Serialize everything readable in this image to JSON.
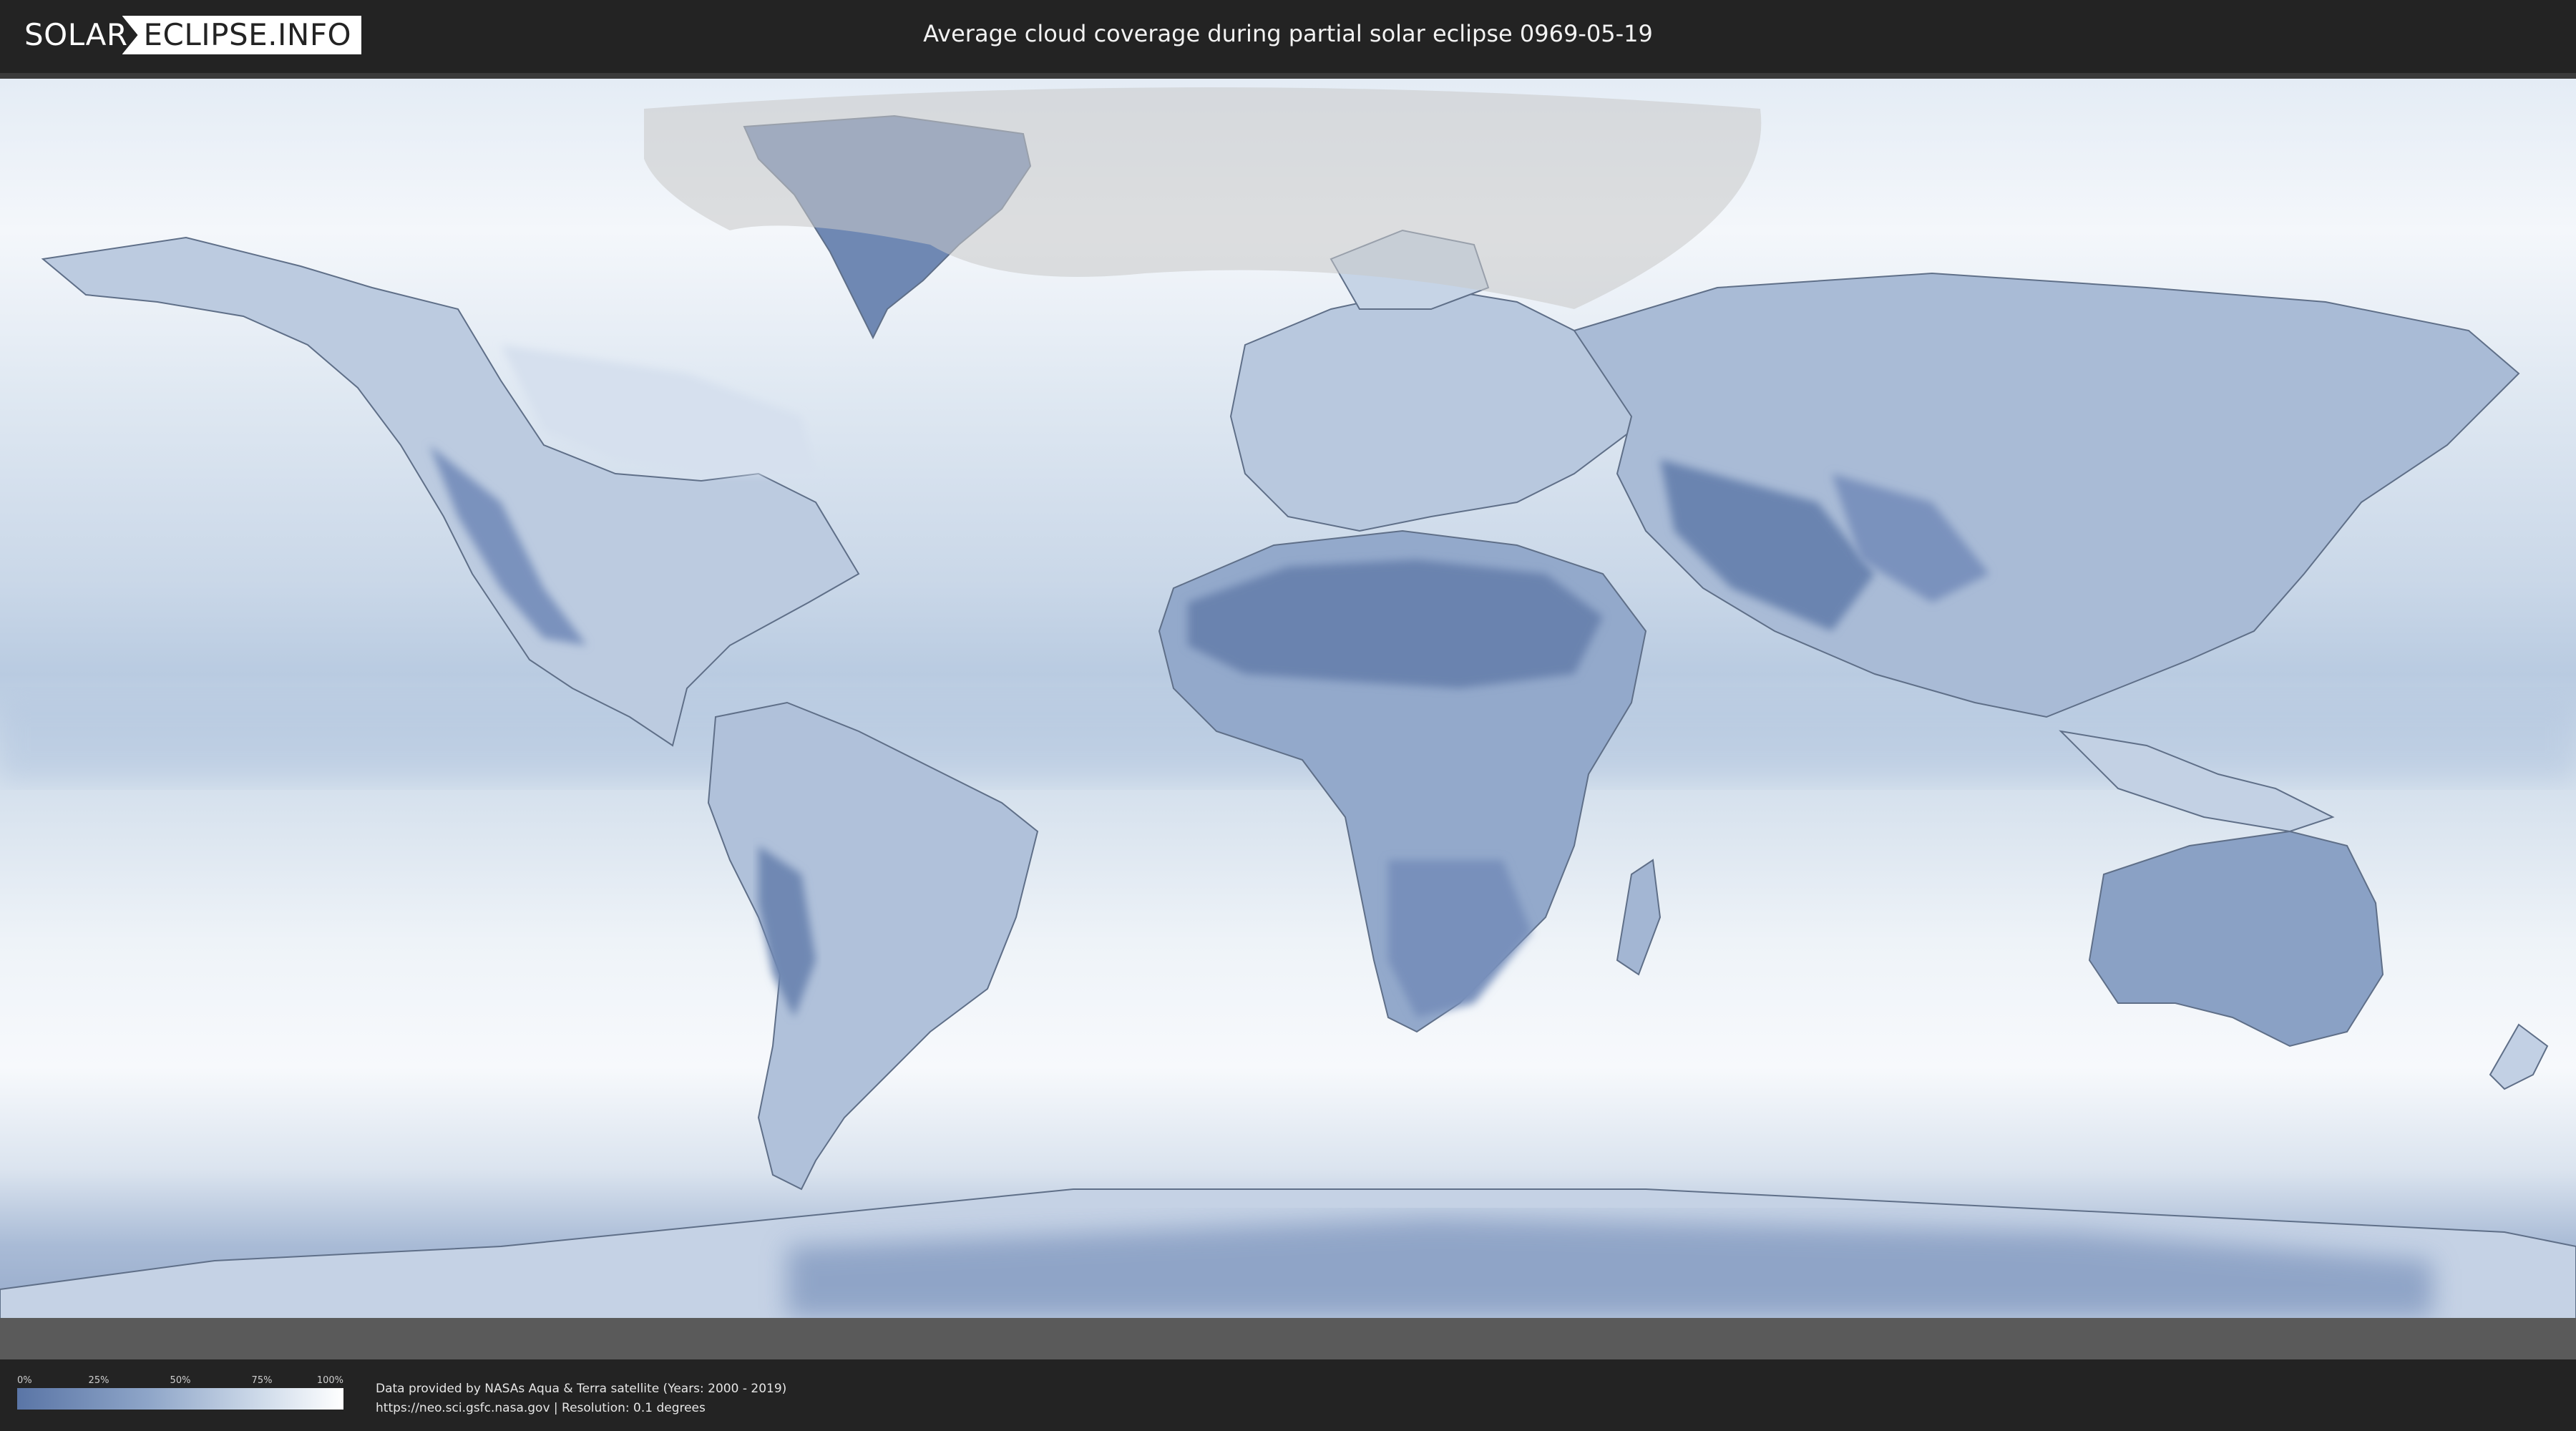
{
  "header": {
    "logo_left": "SOLAR",
    "logo_right": "ECLIPSE.INFO",
    "title": "Average cloud coverage during partial solar eclipse 0969-05-19"
  },
  "map": {
    "colors": {
      "clear": "#5a75a6",
      "cloudy": "#ffffff",
      "eclipse_zone": "#c8c8c8",
      "border": "#5f6f88"
    }
  },
  "legend": {
    "ticks": [
      "0%",
      "25%",
      "50%",
      "75%",
      "100%"
    ]
  },
  "footer": {
    "credit_line_1": "Data provided by NASAs Aqua & Terra satellite (Years: 2000 - 2019)",
    "credit_line_2": "https://neo.sci.gsfc.nasa.gov | Resolution: 0.1 degrees"
  }
}
